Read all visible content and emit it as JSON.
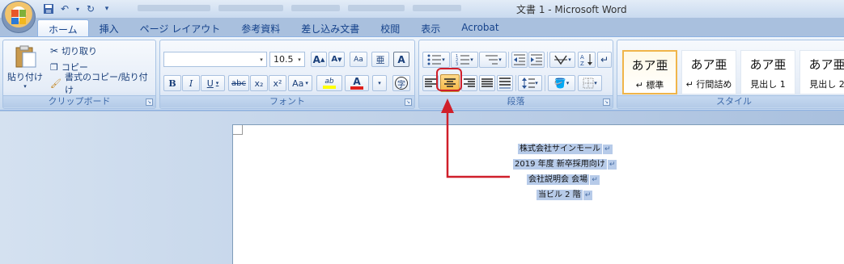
{
  "window": {
    "title": "文書 1 - Microsoft Word"
  },
  "tabs": [
    "ホーム",
    "挿入",
    "ページ レイアウト",
    "参考資料",
    "差し込み文書",
    "校閲",
    "表示",
    "Acrobat"
  ],
  "clipboard": {
    "paste": "貼り付け",
    "cut": "切り取り",
    "copy": "コピー",
    "format_painter": "書式のコピー/貼り付け",
    "group": "クリップボード"
  },
  "font": {
    "name": "",
    "size": "10.5",
    "group": "フォント",
    "grow": "A",
    "shrink": "A",
    "clear": "Aa",
    "phonetic": "亜",
    "border": "A",
    "bold": "B",
    "italic": "I",
    "underline": "U",
    "strike": "abc",
    "sub": "x₂",
    "sup": "x²",
    "case": "Aa",
    "highlight": "ab",
    "color": "A",
    "enclose": "字"
  },
  "paragraph": {
    "group": "段落"
  },
  "styles": {
    "group": "スタイル",
    "items": [
      {
        "sample": "あア亜",
        "name": "↵ 標準"
      },
      {
        "sample": "あア亜",
        "name": "↵ 行間詰め"
      },
      {
        "sample": "あア亜",
        "name": "見出し 1"
      },
      {
        "sample": "あア亜",
        "name": "見出し 2"
      }
    ]
  },
  "document": {
    "lines": [
      "株式会社サインモール",
      "2019 年度 新卒採用向け",
      "会社説明会 会場",
      "当ビル 2 階"
    ],
    "para_mark": "↵"
  },
  "colors": {
    "annotation": "#d01f2a",
    "highlight_selected": "#f5c46a",
    "text_color_bar": "#e0201c",
    "highlight_bar": "#ffff00"
  }
}
